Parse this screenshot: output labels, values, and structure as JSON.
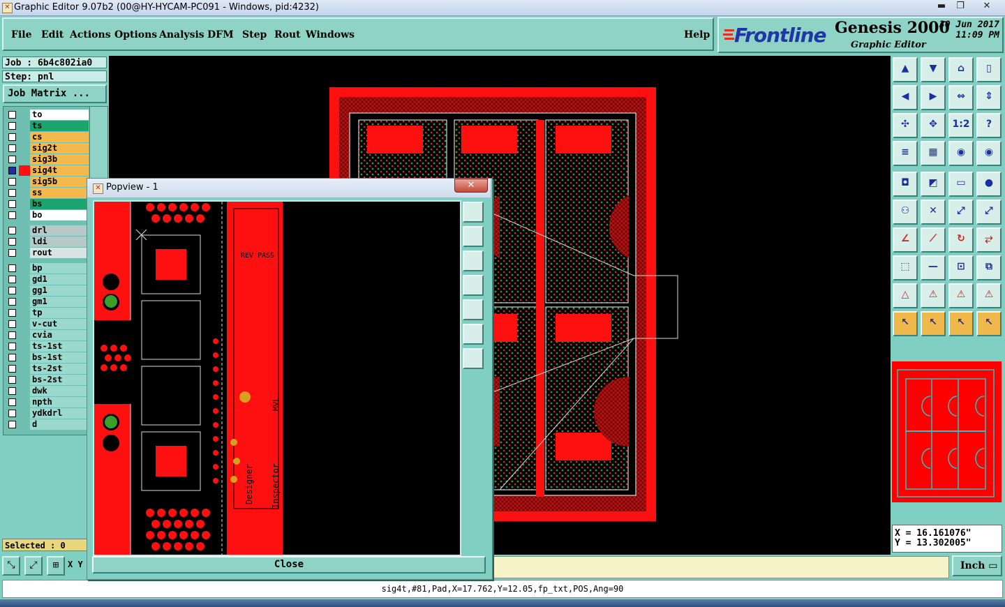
{
  "window": {
    "title": "Graphic Editor 9.07b2 (00@HY-HYCAM-PC091 - Windows, pid:4232)"
  },
  "menu": {
    "file": "File",
    "edit": "Edit",
    "actions": "Actions",
    "options": "Options",
    "analysis": "Analysis",
    "dfm": "DFM",
    "step": "Step",
    "rout": "Rout",
    "windows": "Windows",
    "help": "Help"
  },
  "brand": {
    "logo": "Frontline",
    "product": "Genesis 2000",
    "subtitle": "Graphic Editor",
    "date": "30 Jun 2017",
    "time": "11:09 PM"
  },
  "job": {
    "job_label": "Job : 6b4c802ia0",
    "step_label": "Step: pnl",
    "matrix_button": "Job Matrix ..."
  },
  "layers": [
    {
      "name": "to",
      "color": "#ffffff"
    },
    {
      "name": "ts",
      "color": "#1aa56f"
    },
    {
      "name": "cs",
      "color": "#f5b84a"
    },
    {
      "name": "sig2t",
      "color": "#f5b84a"
    },
    {
      "name": "sig3b",
      "color": "#f5b84a"
    },
    {
      "name": "sig4t",
      "color": "#f5b84a",
      "active": true
    },
    {
      "name": "sig5b",
      "color": "#f5b84a"
    },
    {
      "name": "ss",
      "color": "#f5b84a"
    },
    {
      "name": "bs",
      "color": "#1aa56f"
    },
    {
      "name": "bo",
      "color": "#ffffff"
    },
    {
      "name": "drl",
      "color": "#b6c9c6"
    },
    {
      "name": "ldi",
      "color": "#b6c9c6"
    },
    {
      "name": "rout",
      "color": "#d9e3e1"
    },
    {
      "name": "bp",
      "color": "#9bd8cd"
    },
    {
      "name": "gd1",
      "color": "#9bd8cd"
    },
    {
      "name": "gg1",
      "color": "#9bd8cd"
    },
    {
      "name": "gm1",
      "color": "#9bd8cd"
    },
    {
      "name": "tp",
      "color": "#9bd8cd"
    },
    {
      "name": "v-cut",
      "color": "#9bd8cd"
    },
    {
      "name": "cvia",
      "color": "#9bd8cd"
    },
    {
      "name": "ts-1st",
      "color": "#9bd8cd"
    },
    {
      "name": "bs-1st",
      "color": "#9bd8cd"
    },
    {
      "name": "ts-2st",
      "color": "#9bd8cd"
    },
    {
      "name": "bs-2st",
      "color": "#9bd8cd"
    },
    {
      "name": "dwk",
      "color": "#9bd8cd"
    },
    {
      "name": "npth",
      "color": "#9bd8cd"
    },
    {
      "name": "ydkdrl",
      "color": "#9bd8cd"
    },
    {
      "name": "d",
      "color": "#9bd8cd"
    }
  ],
  "selected": "Selected : 0",
  "xy_label": "X Y",
  "units": "Inch",
  "coords": {
    "x": "X = 16.161076\"",
    "y": "Y = 13.302005\""
  },
  "status": "sig4t,#81,Pad,X=17.762,Y=12.05,fp_txt,POS,Ang=90",
  "popview": {
    "title": "Popview - 1",
    "close_x": "✕",
    "close_button": "Close",
    "text_designer": "Designer",
    "text_inspector": "Inspector",
    "text_mvl": "MVL",
    "text_top": "REV PASS"
  },
  "colors": {
    "bg": "#7fcfc2",
    "copper": "#ff0000",
    "accent": "#1f35a8"
  }
}
